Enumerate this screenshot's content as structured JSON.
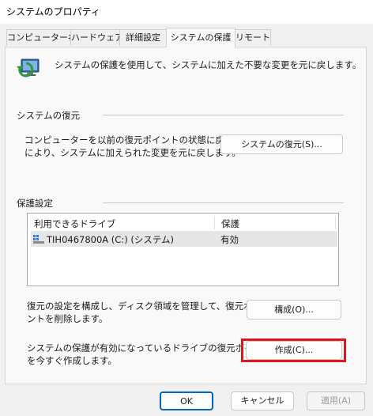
{
  "window": {
    "title": "システムのプロパティ"
  },
  "tabs": [
    {
      "label": "コンピューター名"
    },
    {
      "label": "ハードウェア"
    },
    {
      "label": "詳細設定"
    },
    {
      "label": "システムの保護"
    },
    {
      "label": "リモート"
    }
  ],
  "header": {
    "description": "システムの保護を使用して、システムに加えた不要な変更を元に戻します。"
  },
  "restore": {
    "group_label": "システムの復元",
    "line1": "コンピューターを以前の復元ポイントの状態に戻すこと",
    "line2": "により、システムに加えられた変更を元に戻します。",
    "button": "システムの復元(S)..."
  },
  "protection": {
    "group_label": "保護設定",
    "columns": [
      "利用できるドライブ",
      "保護"
    ],
    "rows": [
      {
        "drive": "TIH0467800A (C:) (システム)",
        "status": "有効"
      }
    ]
  },
  "configure": {
    "line1": "復元の設定を構成し、ディスク領域を管理して、復元ポイ",
    "line2": "ントを削除します。",
    "button": "構成(O)..."
  },
  "create": {
    "line1": "システムの保護が有効になっているドライブの復元ポイント",
    "line2": "を今すぐ作成します。",
    "button": "作成(C)..."
  },
  "footer": {
    "ok": "OK",
    "cancel": "キャンセル",
    "apply": "適用(A)"
  },
  "colors": {
    "highlight": "#e0161d",
    "ok_border": "#0067c0"
  }
}
